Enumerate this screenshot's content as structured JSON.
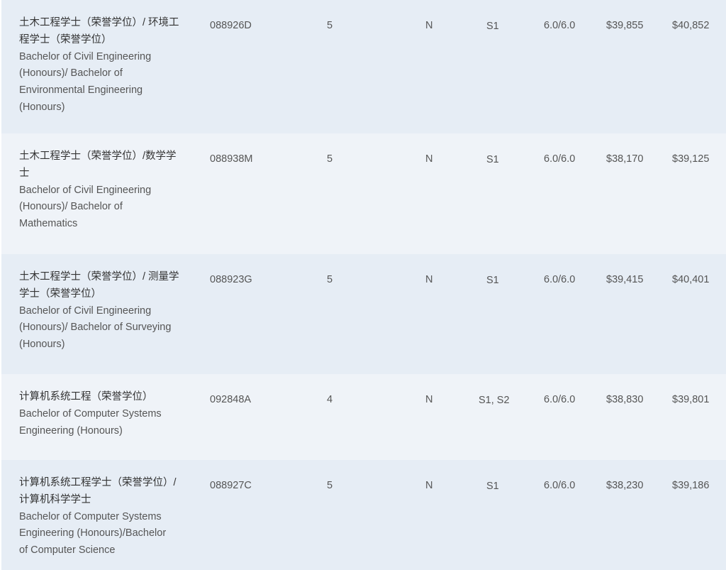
{
  "courses": [
    {
      "name_cn": "土木工程学士（荣誉学位）/ 环境工程学士（荣誉学位）",
      "name_en_lines": [
        "Bachelor of Civil Engineering",
        "(Honours)/ Bachelor of",
        "Environmental Engineering",
        "(Honours)"
      ],
      "code": "088926D",
      "years": "5",
      "flag": "N",
      "semester": "S1",
      "ielts": "6.0/6.0",
      "fee_1": "$39,855",
      "fee_2": "$40,852"
    },
    {
      "name_cn": "土木工程学士（荣誉学位）/数学学士",
      "name_en_lines": [
        "Bachelor of Civil Engineering",
        "(Honours)/ Bachelor of",
        "Mathematics"
      ],
      "code": "088938M",
      "years": "5",
      "flag": "N",
      "semester": "S1",
      "ielts": "6.0/6.0",
      "fee_1": "$38,170",
      "fee_2": "$39,125"
    },
    {
      "name_cn": "土木工程学士（荣誉学位）/ 测量学学士（荣誉学位）",
      "name_en_lines": [
        "Bachelor of Civil Engineering",
        "(Honours)/ Bachelor of Surveying",
        "(Honours)"
      ],
      "code": "088923G",
      "years": "5",
      "flag": "N",
      "semester": "S1",
      "ielts": "6.0/6.0",
      "fee_1": "$39,415",
      "fee_2": "$40,401"
    },
    {
      "name_cn": "计算机系统工程（荣誉学位）",
      "name_en_lines": [
        "Bachelor of Computer Systems",
        "Engineering (Honours)"
      ],
      "code": "092848A",
      "years": "4",
      "flag": "N",
      "semester": "S1, S2",
      "ielts": "6.0/6.0",
      "fee_1": "$38,830",
      "fee_2": "$39,801"
    },
    {
      "name_cn": "计算机系统工程学士（荣誉学位）/ 计算机科学学士",
      "name_en_lines": [
        "Bachelor of Computer Systems",
        "Engineering (Honours)/Bachelor",
        "of Computer Science"
      ],
      "code": "088927C",
      "years": "5",
      "flag": "N",
      "semester": "S1",
      "ielts": "6.0/6.0",
      "fee_1": "$38,230",
      "fee_2": "$39,186"
    }
  ]
}
